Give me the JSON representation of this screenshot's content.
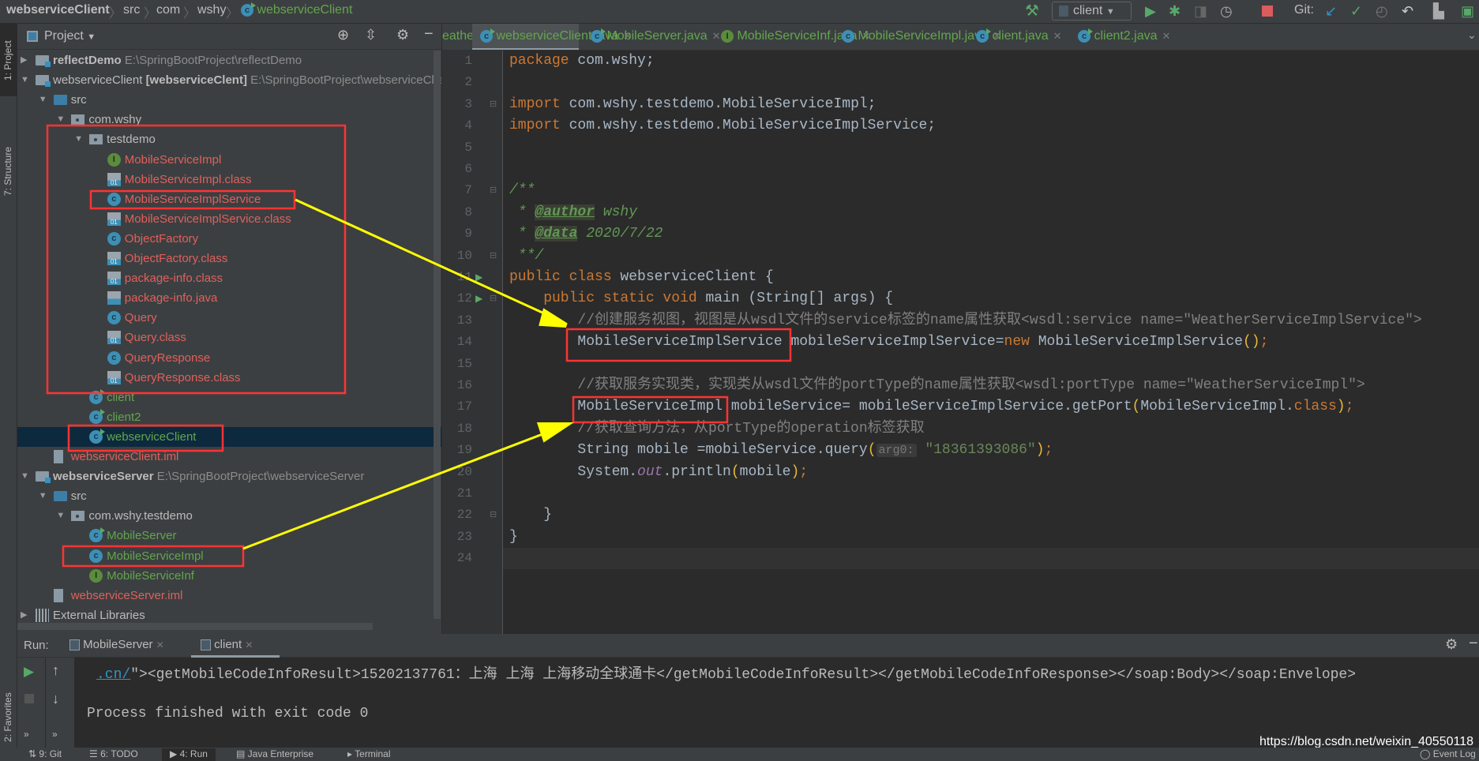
{
  "breadcrumb": [
    "webserviceClient",
    "src",
    "com",
    "wshy",
    "webserviceClient"
  ],
  "toolbar": {
    "run_config": "client",
    "git_label": "Git:"
  },
  "stripe": {
    "project": "1: Project",
    "structure": "7: Structure",
    "favorites": "2: Favorites"
  },
  "project_panel": {
    "title": "Project",
    "tree": [
      {
        "label": "reflectDemo",
        "path": "E:\\SpringBootProject\\reflectDemo",
        "level": 0,
        "arrow": "closed",
        "icon": "module",
        "color": "def",
        "bold": true
      },
      {
        "label": "webserviceClient",
        "extra": "[webserviceClent]",
        "path": "E:\\SpringBootProject\\webserviceClient",
        "level": 0,
        "arrow": "open",
        "icon": "module",
        "color": "def"
      },
      {
        "label": "src",
        "level": 1,
        "arrow": "open",
        "icon": "src",
        "color": "def"
      },
      {
        "label": "com.wshy",
        "level": 2,
        "arrow": "open",
        "icon": "package",
        "color": "def"
      },
      {
        "label": "testdemo",
        "level": 3,
        "arrow": "open",
        "icon": "package",
        "color": "def"
      },
      {
        "label": "MobileServiceImpl",
        "level": 4,
        "icon": "interface",
        "color": "red"
      },
      {
        "label": "MobileServiceImpl.class",
        "level": 4,
        "icon": "classfile",
        "color": "red"
      },
      {
        "label": "MobileServiceImplService",
        "level": 4,
        "icon": "class",
        "color": "red"
      },
      {
        "label": "MobileServiceImplService.class",
        "level": 4,
        "icon": "classfile",
        "color": "red"
      },
      {
        "label": "ObjectFactory",
        "level": 4,
        "icon": "class",
        "color": "red"
      },
      {
        "label": "ObjectFactory.class",
        "level": 4,
        "icon": "classfile",
        "color": "red"
      },
      {
        "label": "package-info.class",
        "level": 4,
        "icon": "classfile",
        "color": "red"
      },
      {
        "label": "package-info.java",
        "level": 4,
        "icon": "javafile",
        "color": "red"
      },
      {
        "label": "Query",
        "level": 4,
        "icon": "class",
        "color": "red"
      },
      {
        "label": "Query.class",
        "level": 4,
        "icon": "classfile",
        "color": "red"
      },
      {
        "label": "QueryResponse",
        "level": 4,
        "icon": "class",
        "color": "red"
      },
      {
        "label": "QueryResponse.class",
        "level": 4,
        "icon": "classfile",
        "color": "red"
      },
      {
        "label": "client",
        "level": 3,
        "icon": "runclass",
        "color": "green"
      },
      {
        "label": "client2",
        "level": 3,
        "icon": "runclass",
        "color": "green"
      },
      {
        "label": "webserviceClient",
        "level": 3,
        "icon": "runclass",
        "color": "green",
        "selected": true
      },
      {
        "label": "webserviceClient.iml",
        "level": 1,
        "icon": "iml",
        "color": "red"
      },
      {
        "label": "webserviceServer",
        "path": "E:\\SpringBootProject\\webserviceServer",
        "level": 0,
        "arrow": "open",
        "icon": "module",
        "color": "def",
        "bold": true
      },
      {
        "label": "src",
        "level": 1,
        "arrow": "open",
        "icon": "src",
        "color": "def"
      },
      {
        "label": "com.wshy.testdemo",
        "level": 2,
        "arrow": "open",
        "icon": "package",
        "color": "def"
      },
      {
        "label": "MobileServer",
        "level": 3,
        "icon": "runclass",
        "color": "green"
      },
      {
        "label": "MobileServiceImpl",
        "level": 3,
        "icon": "class",
        "color": "green"
      },
      {
        "label": "MobileServiceInf",
        "level": 3,
        "icon": "interface",
        "color": "green"
      },
      {
        "label": "webserviceServer.iml",
        "level": 1,
        "icon": "iml",
        "color": "red"
      },
      {
        "label": "External Libraries",
        "level": 0,
        "arrow": "closed",
        "icon": "library",
        "color": "def"
      }
    ]
  },
  "editor_tabs": [
    {
      "label": "eatherServer.java",
      "icon": "none"
    },
    {
      "label": "webserviceClient.java",
      "icon": "runclass",
      "active": true
    },
    {
      "label": "MobileServer.java",
      "icon": "runclass"
    },
    {
      "label": "MobileServiceInf.java",
      "icon": "interface"
    },
    {
      "label": "MobileServiceImpl.java",
      "icon": "class"
    },
    {
      "label": "client.java",
      "icon": "runclass"
    },
    {
      "label": "client2.java",
      "icon": "runclass"
    }
  ],
  "code": [
    [
      [
        "package",
        "kw"
      ],
      [
        " com.wshy;",
        "pl"
      ]
    ],
    [],
    [
      [
        "import",
        "kw"
      ],
      [
        " com.wshy.testdemo.MobileServiceImpl;",
        "pl"
      ]
    ],
    [
      [
        "import",
        "kw"
      ],
      [
        " com.wshy.testdemo.MobileServiceImplService;",
        "pl"
      ]
    ],
    [],
    [],
    [
      [
        "/**",
        "jd"
      ]
    ],
    [
      [
        " * ",
        "jd"
      ],
      [
        "@author",
        "jt"
      ],
      [
        " wshy",
        "jd"
      ]
    ],
    [
      [
        " * ",
        "jd"
      ],
      [
        "@data",
        "jt"
      ],
      [
        " 2020/7/22",
        "jd"
      ]
    ],
    [
      [
        " **/",
        "jd"
      ]
    ],
    [
      [
        "public class",
        "kw"
      ],
      [
        " webserviceClient {",
        "pl"
      ]
    ],
    [
      [
        "    public static void",
        "kw"
      ],
      [
        " main (String[] args) {",
        "pl"
      ]
    ],
    [
      [
        "        //创建服务视图，视图是从wsdl文件的service标签的name属性获取<wsdl:service name=\"WeatherServiceImplService\">",
        "cm"
      ]
    ],
    [
      [
        "        MobileServiceImplService mobileServiceImplService=",
        "pl"
      ],
      [
        "new",
        "kw"
      ],
      [
        " MobileServiceImplService",
        "pl"
      ],
      [
        "()",
        "br"
      ],
      [
        ";",
        "kw"
      ]
    ],
    [],
    [
      [
        "        //获取服务实现类，实现类从wsdl文件的portType的name属性获取<wsdl:portType name=\"WeatherServiceImpl\">",
        "cm"
      ]
    ],
    [
      [
        "        MobileServiceImpl mobileService= mobileServiceImplService.getPort",
        "pl"
      ],
      [
        "(",
        "br"
      ],
      [
        "MobileServiceImpl.",
        "pl"
      ],
      [
        "class",
        "kw"
      ],
      [
        ")",
        "br"
      ],
      [
        ";",
        "kw"
      ]
    ],
    [
      [
        "        //获取查询方法，从portType的operation标签获取",
        "cm"
      ]
    ],
    [
      [
        "        String mobile =mobileService.query",
        "pl"
      ],
      [
        "(",
        "br"
      ],
      [
        "arg0:",
        "hint"
      ],
      [
        " \"18361393086\"",
        "st"
      ],
      [
        ")",
        "br"
      ],
      [
        ";",
        "kw"
      ]
    ],
    [
      [
        "        System.",
        "pl"
      ],
      [
        "out",
        "fn"
      ],
      [
        ".println",
        "pl"
      ],
      [
        "(",
        "br"
      ],
      [
        "mobile",
        "pl"
      ],
      [
        ")",
        "br"
      ],
      [
        ";",
        "kw"
      ]
    ],
    [],
    [
      [
        "    }",
        "pl"
      ]
    ],
    [
      [
        "}",
        "pl"
      ]
    ],
    []
  ],
  "run_panel": {
    "label": "Run:",
    "tabs": [
      {
        "label": "MobileServer"
      },
      {
        "label": "client",
        "active": true
      }
    ],
    "console": {
      "link": ".cn/",
      "line1": "\"><getMobileCodeInfoResult>15202137761：上海 上海 上海移动全球通卡</getMobileCodeInfoResult></getMobileCodeInfoResponse></soap:Body></soap:Envelope>",
      "line2": "Process finished with exit code 0"
    }
  },
  "bottom_bar": {
    "items": [
      "9: Git",
      "6: TODO",
      "4: Run",
      "Java Enterprise",
      "Terminal"
    ],
    "event_log": "Event Log"
  },
  "watermark": "https://blog.csdn.net/weixin_40550118",
  "colors": {
    "annotation_box": "#ff3333",
    "annotation_arrow": "#ffff00",
    "editor_bg": "#2b2b2b",
    "panel_bg": "#3c3f41"
  }
}
